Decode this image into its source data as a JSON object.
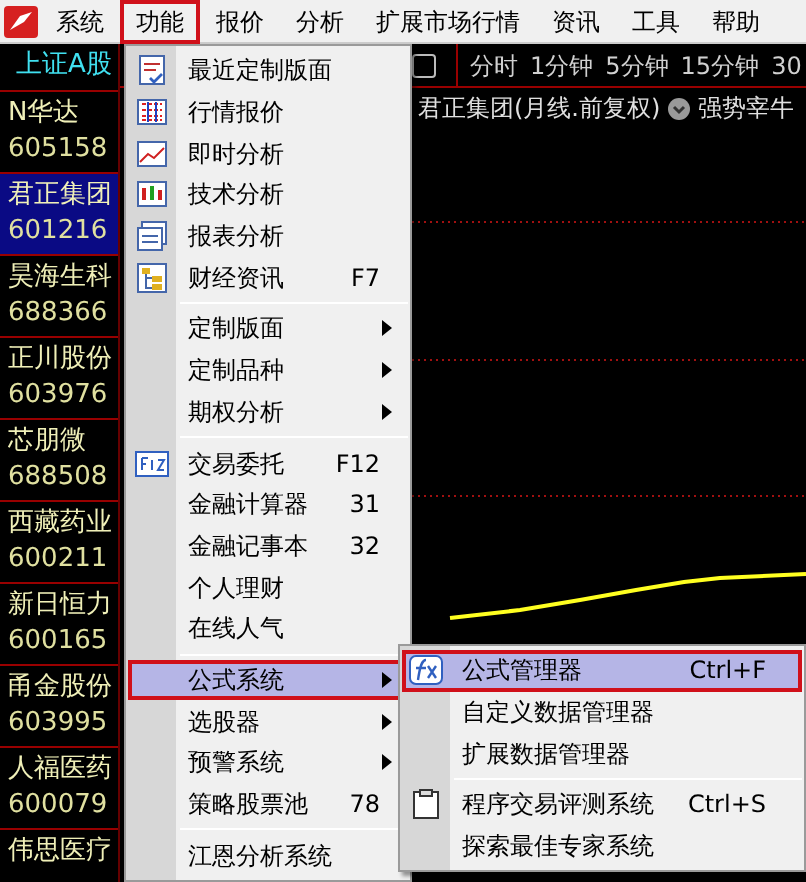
{
  "menubar": [
    {
      "label": "系统",
      "selected": false
    },
    {
      "label": "功能",
      "selected": true
    },
    {
      "label": "报价",
      "selected": false
    },
    {
      "label": "分析",
      "selected": false
    },
    {
      "label": "扩展市场行情",
      "selected": false
    },
    {
      "label": "资讯",
      "selected": false
    },
    {
      "label": "工具",
      "selected": false
    },
    {
      "label": "帮助",
      "selected": false
    }
  ],
  "sidebar": {
    "header": "上证A股",
    "stocks": [
      {
        "name": "N华达",
        "code": "605158",
        "selected": false
      },
      {
        "name": "君正集团",
        "code": "601216",
        "selected": true
      },
      {
        "name": "昊海生科",
        "code": "688366",
        "selected": false
      },
      {
        "name": "正川股份",
        "code": "603976",
        "selected": false
      },
      {
        "name": "芯朋微",
        "code": "688508",
        "selected": false
      },
      {
        "name": "西藏药业",
        "code": "600211",
        "selected": false
      },
      {
        "name": "新日恒力",
        "code": "600165",
        "selected": false
      },
      {
        "name": "甬金股份",
        "code": "603995",
        "selected": false
      },
      {
        "name": "人福医药",
        "code": "600079",
        "selected": false
      },
      {
        "name": "伟思医疗",
        "selected": false
      }
    ]
  },
  "chart": {
    "periods": [
      "分时",
      "1分钟",
      "5分钟",
      "15分钟",
      "30"
    ],
    "title": "君正集团(月线.前复权)",
    "indicator": "强势宰牛"
  },
  "menu": {
    "items": [
      {
        "kind": "item",
        "label": "最近定制版面",
        "selected": false
      },
      {
        "kind": "item",
        "label": "行情报价",
        "selected": false
      },
      {
        "kind": "item",
        "label": "即时分析",
        "selected": false
      },
      {
        "kind": "item",
        "label": "技术分析",
        "selected": false
      },
      {
        "kind": "item",
        "label": "报表分析",
        "selected": false
      },
      {
        "kind": "item",
        "label": "财经资讯",
        "shortcut": "F7",
        "selected": false
      },
      {
        "kind": "separator"
      },
      {
        "kind": "item",
        "label": "定制版面",
        "submenu": true,
        "selected": false
      },
      {
        "kind": "item",
        "label": "定制品种",
        "submenu": true,
        "selected": false
      },
      {
        "kind": "item",
        "label": "期权分析",
        "submenu": true,
        "selected": false
      },
      {
        "kind": "separator"
      },
      {
        "kind": "item",
        "label": "交易委托",
        "shortcut": "F12",
        "selected": false
      },
      {
        "kind": "item",
        "label": "金融计算器",
        "shortcut": "31",
        "selected": false
      },
      {
        "kind": "item",
        "label": "金融记事本",
        "shortcut": "32",
        "selected": false
      },
      {
        "kind": "item",
        "label": "个人理财",
        "selected": false
      },
      {
        "kind": "item",
        "label": "在线人气",
        "selected": false
      },
      {
        "kind": "separator"
      },
      {
        "kind": "item",
        "label": "公式系统",
        "submenu": true,
        "selected": true
      },
      {
        "kind": "item",
        "label": "选股器",
        "submenu": true,
        "selected": false
      },
      {
        "kind": "item",
        "label": "预警系统",
        "submenu": true,
        "selected": false
      },
      {
        "kind": "item",
        "label": "策略股票池",
        "shortcut": "78",
        "selected": false
      },
      {
        "kind": "separator"
      },
      {
        "kind": "item",
        "label": "江恩分析系统",
        "selected": false
      }
    ]
  },
  "submenu": {
    "items": [
      {
        "kind": "item",
        "label": "公式管理器",
        "shortcut": "Ctrl+F",
        "selected": true
      },
      {
        "kind": "item",
        "label": "自定义数据管理器",
        "selected": false
      },
      {
        "kind": "item",
        "label": "扩展数据管理器",
        "selected": false
      },
      {
        "kind": "separator"
      },
      {
        "kind": "item",
        "label": "程序交易评测系统",
        "shortcut": "Ctrl+S",
        "selected": false
      },
      {
        "kind": "item",
        "label": "探索最佳专家系统",
        "selected": false
      }
    ]
  }
}
